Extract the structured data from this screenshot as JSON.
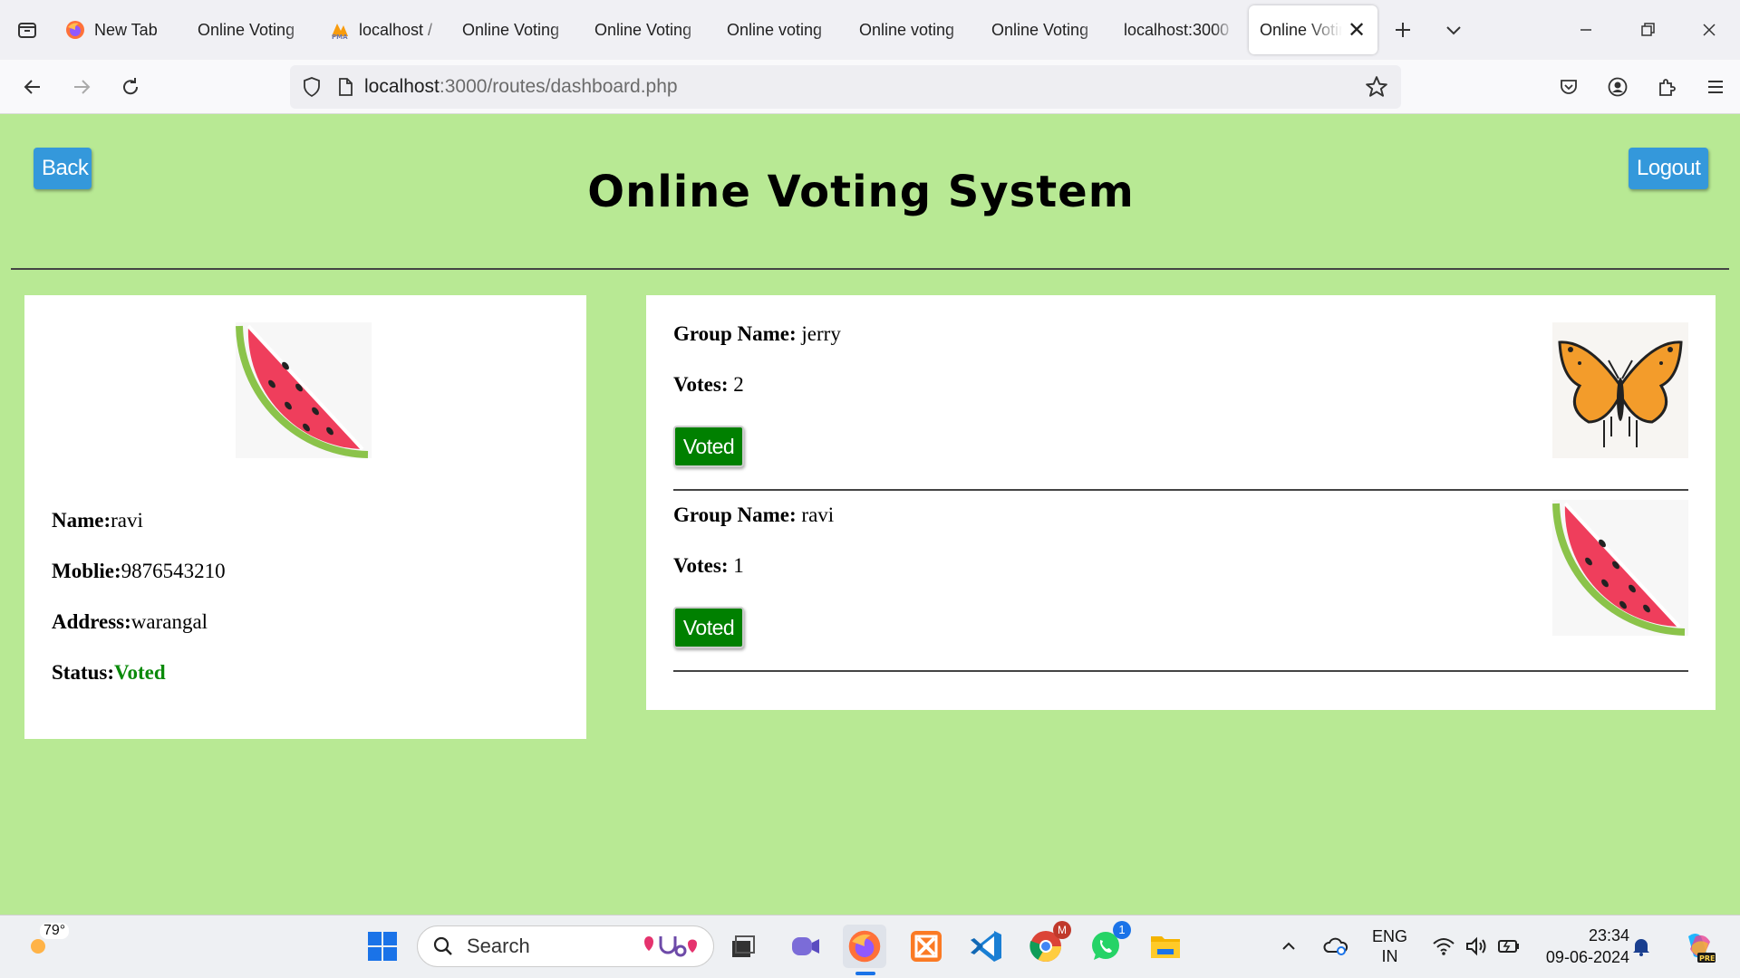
{
  "browser": {
    "tabs": [
      {
        "title": "New Tab",
        "favicon": "firefox-icon"
      },
      {
        "title": "Online Voting",
        "favicon": ""
      },
      {
        "title": "localhost /",
        "favicon": "phpmyadmin-icon"
      },
      {
        "title": "Online Voting",
        "favicon": ""
      },
      {
        "title": "Online Voting",
        "favicon": ""
      },
      {
        "title": "Online voting",
        "favicon": ""
      },
      {
        "title": "Online voting",
        "favicon": ""
      },
      {
        "title": "Online Voting",
        "favicon": ""
      },
      {
        "title": "localhost:3000",
        "favicon": ""
      },
      {
        "title": "Online Voting",
        "favicon": "",
        "active": true
      }
    ],
    "url_host": "localhost",
    "url_path": ":3000/routes/dashboard.php"
  },
  "page": {
    "title": "Online Voting System",
    "back_label": "Back",
    "logout_label": "Logout",
    "profile": {
      "image": "watermelon-icon",
      "name_label": "Name:",
      "name_value": "ravi",
      "mobile_label": "Moblie:",
      "mobile_value": "9876543210",
      "address_label": "Address:",
      "address_value": "warangal",
      "status_label": "Status:",
      "status_value": "Voted"
    },
    "groups": [
      {
        "name_label": "Group Name:",
        "name": "jerry",
        "votes_label": "Votes:",
        "votes": "2",
        "button_label": "Voted",
        "image": "butterfly-icon"
      },
      {
        "name_label": "Group Name:",
        "name": "ravi",
        "votes_label": "Votes:",
        "votes": "1",
        "button_label": "Voted",
        "image": "watermelon-icon"
      }
    ]
  },
  "taskbar": {
    "weather_temp": "79°",
    "search_placeholder": "Search",
    "lang_line1": "ENG",
    "lang_line2": "IN",
    "time": "23:34",
    "date": "09-06-2024",
    "whatsapp_badge": "1",
    "chrome_badge": "M"
  },
  "colors": {
    "page_bg": "#b8e994",
    "button_blue": "#3498db",
    "voted_green": "#008000",
    "status_green": "#0a8a0a"
  }
}
